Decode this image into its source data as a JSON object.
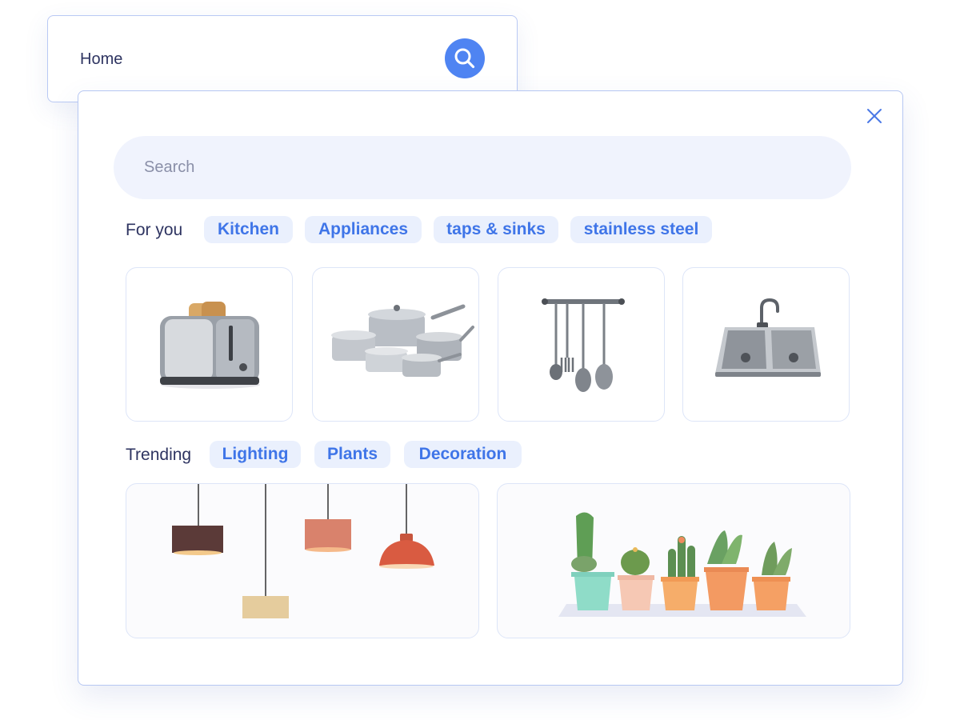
{
  "homebar": {
    "label": "Home"
  },
  "search": {
    "placeholder": "Search"
  },
  "for_you": {
    "label": "For you",
    "chips": [
      "Kitchen",
      "Appliances",
      "taps & sinks",
      "stainless steel"
    ],
    "products": [
      {
        "name": "toaster"
      },
      {
        "name": "cookware set"
      },
      {
        "name": "utensil rail"
      },
      {
        "name": "double sink"
      }
    ]
  },
  "trending": {
    "label": "Trending",
    "chips": [
      "Lighting",
      "Plants",
      "Decoration"
    ],
    "cards": [
      {
        "name": "pendant lights"
      },
      {
        "name": "potted cacti"
      }
    ]
  },
  "colors": {
    "accent": "#4f84f2",
    "chip_bg": "#eaf0fd",
    "chip_text": "#3f75e8",
    "border": "#b6c7f2"
  }
}
